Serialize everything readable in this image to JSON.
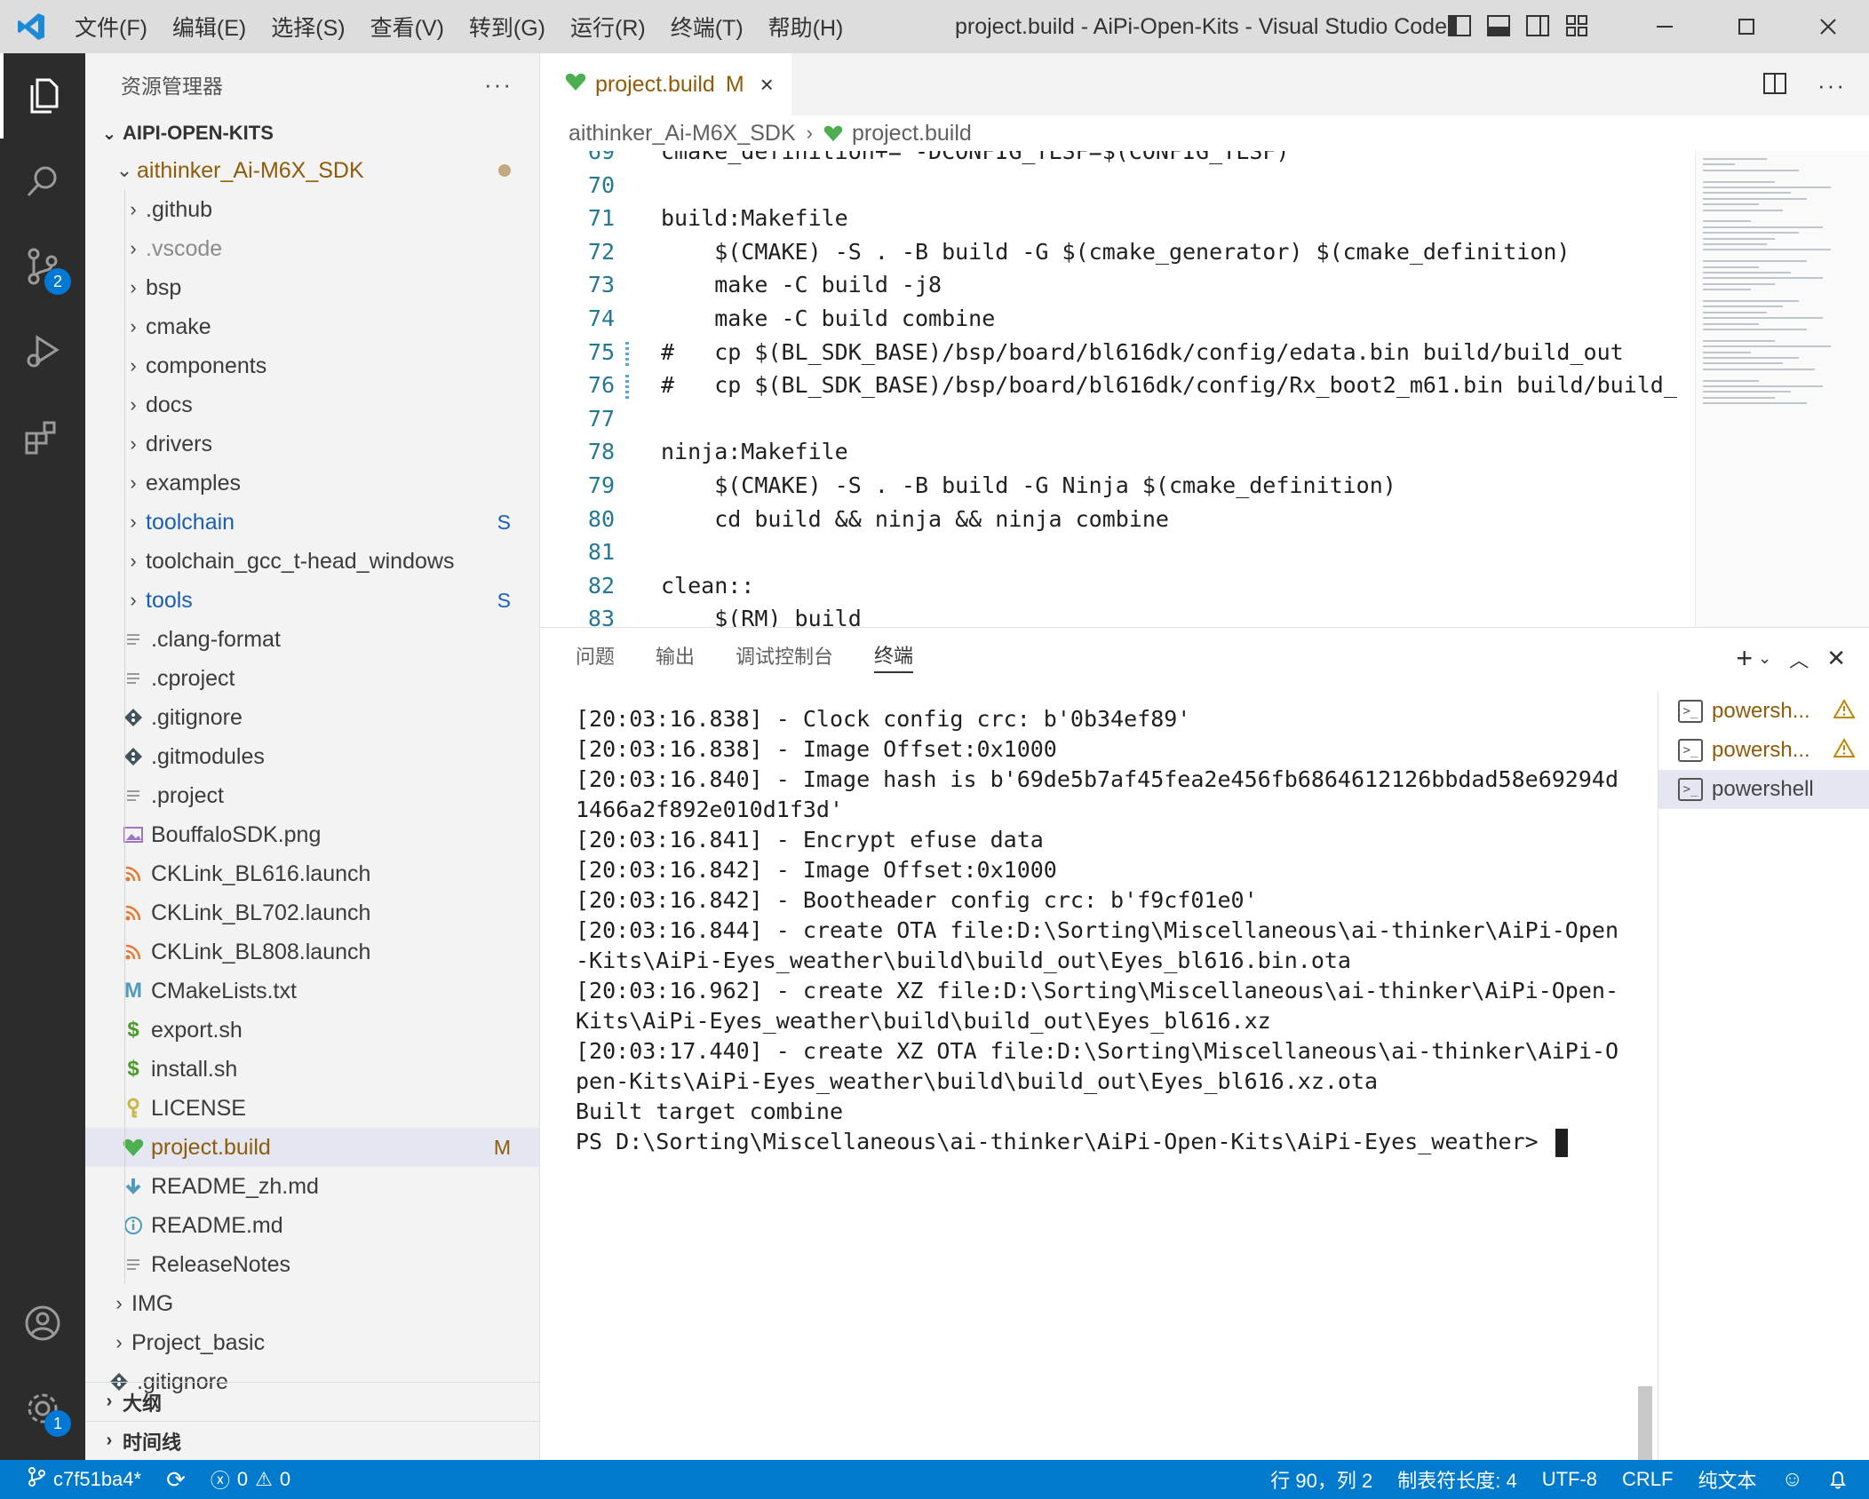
{
  "window": {
    "title": "project.build - AiPi-Open-Kits - Visual Studio Code",
    "menu": [
      "文件(F)",
      "编辑(E)",
      "选择(S)",
      "查看(V)",
      "转到(G)",
      "运行(R)",
      "终端(T)",
      "帮助(H)"
    ]
  },
  "activity": {
    "scm_badge": "2",
    "settings_badge": "1"
  },
  "sidebar": {
    "header": "资源管理器",
    "more": "···",
    "root": "AIPI-OPEN-KITS",
    "folder": "aithinker_Ai-M6X_SDK",
    "items": [
      {
        "label": ".github",
        "kind": "folder"
      },
      {
        "label": ".vscode",
        "kind": "folder",
        "dim": true
      },
      {
        "label": "bsp",
        "kind": "folder"
      },
      {
        "label": "cmake",
        "kind": "folder"
      },
      {
        "label": "components",
        "kind": "folder"
      },
      {
        "label": "docs",
        "kind": "folder"
      },
      {
        "label": "drivers",
        "kind": "folder"
      },
      {
        "label": "examples",
        "kind": "folder"
      },
      {
        "label": "toolchain",
        "kind": "folder",
        "deco": "S"
      },
      {
        "label": "toolchain_gcc_t-head_windows",
        "kind": "folder"
      },
      {
        "label": "tools",
        "kind": "folder",
        "deco": "S"
      },
      {
        "label": ".clang-format",
        "kind": "file",
        "icon": "lines"
      },
      {
        "label": ".cproject",
        "kind": "file",
        "icon": "lines"
      },
      {
        "label": ".gitignore",
        "kind": "file",
        "icon": "git"
      },
      {
        "label": ".gitmodules",
        "kind": "file",
        "icon": "git"
      },
      {
        "label": ".project",
        "kind": "file",
        "icon": "lines"
      },
      {
        "label": "BouffaloSDK.png",
        "kind": "file",
        "icon": "image"
      },
      {
        "label": "CKLink_BL616.launch",
        "kind": "file",
        "icon": "rss"
      },
      {
        "label": "CKLink_BL702.launch",
        "kind": "file",
        "icon": "rss"
      },
      {
        "label": "CKLink_BL808.launch",
        "kind": "file",
        "icon": "rss"
      },
      {
        "label": "CMakeLists.txt",
        "kind": "file",
        "icon": "cmake"
      },
      {
        "label": "export.sh",
        "kind": "file",
        "icon": "shell"
      },
      {
        "label": "install.sh",
        "kind": "file",
        "icon": "shell"
      },
      {
        "label": "LICENSE",
        "kind": "file",
        "icon": "license"
      },
      {
        "label": "project.build",
        "kind": "file",
        "icon": "heart",
        "deco": "M",
        "selected": true
      },
      {
        "label": "README_zh.md",
        "kind": "file",
        "icon": "download"
      },
      {
        "label": "README.md",
        "kind": "file",
        "icon": "info"
      },
      {
        "label": "ReleaseNotes",
        "kind": "file",
        "icon": "lines"
      }
    ],
    "root_items": [
      {
        "label": "IMG",
        "kind": "folder"
      },
      {
        "label": "Project_basic",
        "kind": "folder"
      },
      {
        "label": ".gitignore",
        "kind": "file",
        "icon": "git"
      }
    ],
    "outline": "大纲",
    "timeline": "时间线"
  },
  "editor": {
    "tab": {
      "label": "project.build",
      "modified": "M",
      "close": "×"
    },
    "breadcrumb": [
      "aithinker_Ai-M6X_SDK",
      "project.build"
    ],
    "lines": [
      {
        "n": "69",
        "t": "cmake_definition+= -DCONFIG_TLSF=$(CONFIG_TLSF)"
      },
      {
        "n": "70",
        "t": ""
      },
      {
        "n": "71",
        "t": "build:Makefile"
      },
      {
        "n": "72",
        "t": "    $(CMAKE) -S . -B build -G $(cmake_generator) $(cmake_definition)"
      },
      {
        "n": "73",
        "t": "    make -C build -j8"
      },
      {
        "n": "74",
        "t": "    make -C build combine"
      },
      {
        "n": "75",
        "t": "#   cp $(BL_SDK_BASE)/bsp/board/bl616dk/config/edata.bin build/build_out",
        "mod": true
      },
      {
        "n": "76",
        "t": "#   cp $(BL_SDK_BASE)/bsp/board/bl616dk/config/Rx_boot2_m61.bin build/build_",
        "mod": true
      },
      {
        "n": "77",
        "t": ""
      },
      {
        "n": "78",
        "t": "ninja:Makefile"
      },
      {
        "n": "79",
        "t": "    $(CMAKE) -S . -B build -G Ninja $(cmake_definition)"
      },
      {
        "n": "80",
        "t": "    cd build && ninja && ninja combine"
      },
      {
        "n": "81",
        "t": ""
      },
      {
        "n": "82",
        "t": "clean::"
      },
      {
        "n": "83",
        "t": "    $(RM) build"
      }
    ]
  },
  "panel": {
    "tabs": [
      "问题",
      "输出",
      "调试控制台",
      "终端"
    ],
    "active_tab": "终端",
    "terminal_lines": [
      "[20:03:16.838] - Clock config crc: b'0b34ef89'",
      "[20:03:16.838] - Image Offset:0x1000",
      "[20:03:16.840] - Image hash is b'69de5b7af45fea2e456fb6864612126bbdad58e69294d",
      "1466a2f892e010d1f3d'",
      "[20:03:16.841] - Encrypt efuse data",
      "[20:03:16.842] - Image Offset:0x1000",
      "[20:03:16.842] - Bootheader config crc: b'f9cf01e0'",
      "[20:03:16.844] - create OTA file:D:\\Sorting\\Miscellaneous\\ai-thinker\\AiPi-Open",
      "-Kits\\AiPi-Eyes_weather\\build\\build_out\\Eyes_bl616.bin.ota",
      "[20:03:16.962] - create XZ file:D:\\Sorting\\Miscellaneous\\ai-thinker\\AiPi-Open-",
      "Kits\\AiPi-Eyes_weather\\build\\build_out\\Eyes_bl616.xz",
      "[20:03:17.440] - create XZ OTA file:D:\\Sorting\\Miscellaneous\\ai-thinker\\AiPi-O",
      "pen-Kits\\AiPi-Eyes_weather\\build\\build_out\\Eyes_bl616.xz.ota",
      "Built target combine"
    ],
    "prompt": "PS D:\\Sorting\\Miscellaneous\\ai-thinker\\AiPi-Open-Kits\\AiPi-Eyes_weather> ",
    "terminals": [
      {
        "label": "powersh...",
        "warn": true
      },
      {
        "label": "powersh...",
        "warn": true
      },
      {
        "label": "powershell",
        "warn": false,
        "active": true
      }
    ]
  },
  "statusbar": {
    "branch": "c7f51ba4*",
    "errors": "0",
    "warnings": "0",
    "position": "行 90，列 2",
    "tab_size": "制表符长度: 4",
    "encoding": "UTF-8",
    "eol": "CRLF",
    "language": "纯文本"
  },
  "colors": {
    "accent": "#007acc",
    "modified": "#8e5c0b",
    "untracked": "#1a5fb4",
    "activity_bg": "#2c2c2c"
  }
}
